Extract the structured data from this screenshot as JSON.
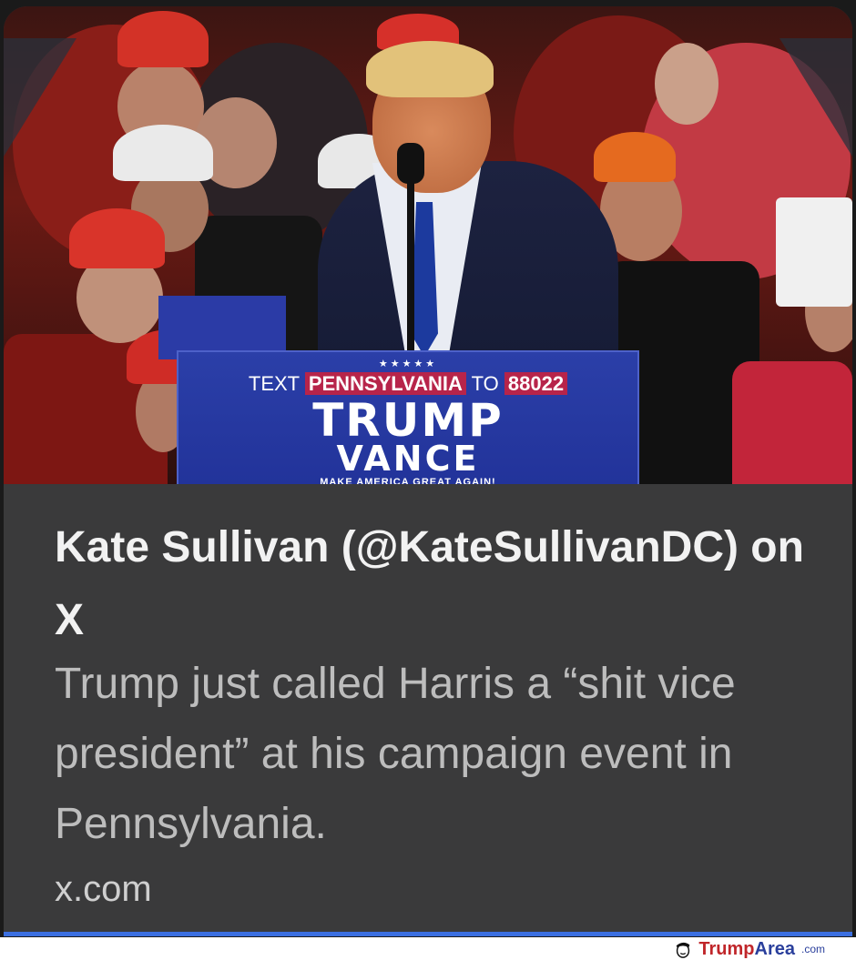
{
  "card": {
    "podium": {
      "stars": "★★★★★",
      "text_prefix": "TEXT",
      "text_keyword": "PENNSYLVANIA",
      "text_middle": "TO",
      "text_number": "88022",
      "name_top": "TRUMP",
      "name_bottom": "VANCE",
      "slogan": "MAKE AMERICA GREAT AGAIN!"
    },
    "title": "Kate Sullivan (@KateSullivanDC) on X",
    "description": "Trump just called Harris a “shit vice president” at his campaign event in Pennsylvania.",
    "domain": "x.com"
  },
  "colors": {
    "card_bg": "#3a3a3b",
    "accent_bar": "#3b6fe0",
    "podium_blue": "#22339a",
    "podium_highlight": "#b7244a"
  },
  "watermark": {
    "brand": "Trump",
    "brand_accent": "Area",
    "suffix": ".com",
    "icon": "trump-face-icon"
  }
}
